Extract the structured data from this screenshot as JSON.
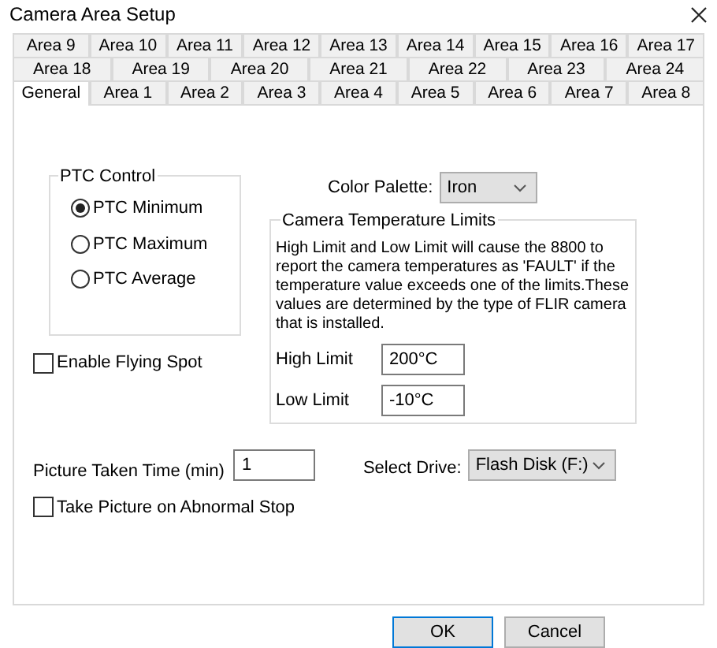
{
  "window": {
    "title": "Camera Area Setup"
  },
  "tab_rows": [
    [
      {
        "label": "Area 9",
        "selected": false
      },
      {
        "label": "Area 10",
        "selected": false
      },
      {
        "label": "Area 11",
        "selected": false
      },
      {
        "label": "Area 12",
        "selected": false
      },
      {
        "label": "Area 13",
        "selected": false
      },
      {
        "label": "Area 14",
        "selected": false
      },
      {
        "label": "Area 15",
        "selected": false
      },
      {
        "label": "Area 16",
        "selected": false
      },
      {
        "label": "Area 17",
        "selected": false
      }
    ],
    [
      {
        "label": "Area 18",
        "selected": false
      },
      {
        "label": "Area 19",
        "selected": false
      },
      {
        "label": "Area 20",
        "selected": false
      },
      {
        "label": "Area 21",
        "selected": false
      },
      {
        "label": "Area 22",
        "selected": false
      },
      {
        "label": "Area 23",
        "selected": false
      },
      {
        "label": "Area 24",
        "selected": false
      }
    ],
    [
      {
        "label": "General",
        "selected": true
      },
      {
        "label": "Area 1",
        "selected": false
      },
      {
        "label": "Area 2",
        "selected": false
      },
      {
        "label": "Area 3",
        "selected": false
      },
      {
        "label": "Area 4",
        "selected": false
      },
      {
        "label": "Area 5",
        "selected": false
      },
      {
        "label": "Area 6",
        "selected": false
      },
      {
        "label": "Area 7",
        "selected": false
      },
      {
        "label": "Area 8",
        "selected": false
      }
    ]
  ],
  "ptc_control": {
    "title": "PTC Control",
    "options": [
      {
        "label": "PTC Minimum",
        "selected": true
      },
      {
        "label": "PTC Maximum",
        "selected": false
      },
      {
        "label": "PTC Average",
        "selected": false
      }
    ]
  },
  "flying_spot": {
    "label": "Enable Flying Spot",
    "checked": false
  },
  "color_palette": {
    "label": "Color Palette:",
    "value": "Iron"
  },
  "temperature_limits": {
    "title": "Camera Temperature Limits",
    "description": "High Limit and Low Limit will cause the 8800 to report the camera temperatures as 'FAULT' if the temperature value exceeds one of the limits.These values are determined by the type of FLIR camera that is installed.",
    "high": {
      "label": "High Limit",
      "value": "200°C"
    },
    "low": {
      "label": "Low Limit",
      "value": "-10°C"
    }
  },
  "picture_time": {
    "label": "Picture Taken Time (min)",
    "value": "1"
  },
  "select_drive": {
    "label": "Select Drive:",
    "value": "Flash Disk (F:)"
  },
  "abnormal_stop": {
    "label": "Take Picture on Abnormal Stop",
    "checked": false
  },
  "buttons": [
    {
      "label": "OK",
      "default": true
    },
    {
      "label": "Cancel",
      "default": false
    }
  ]
}
